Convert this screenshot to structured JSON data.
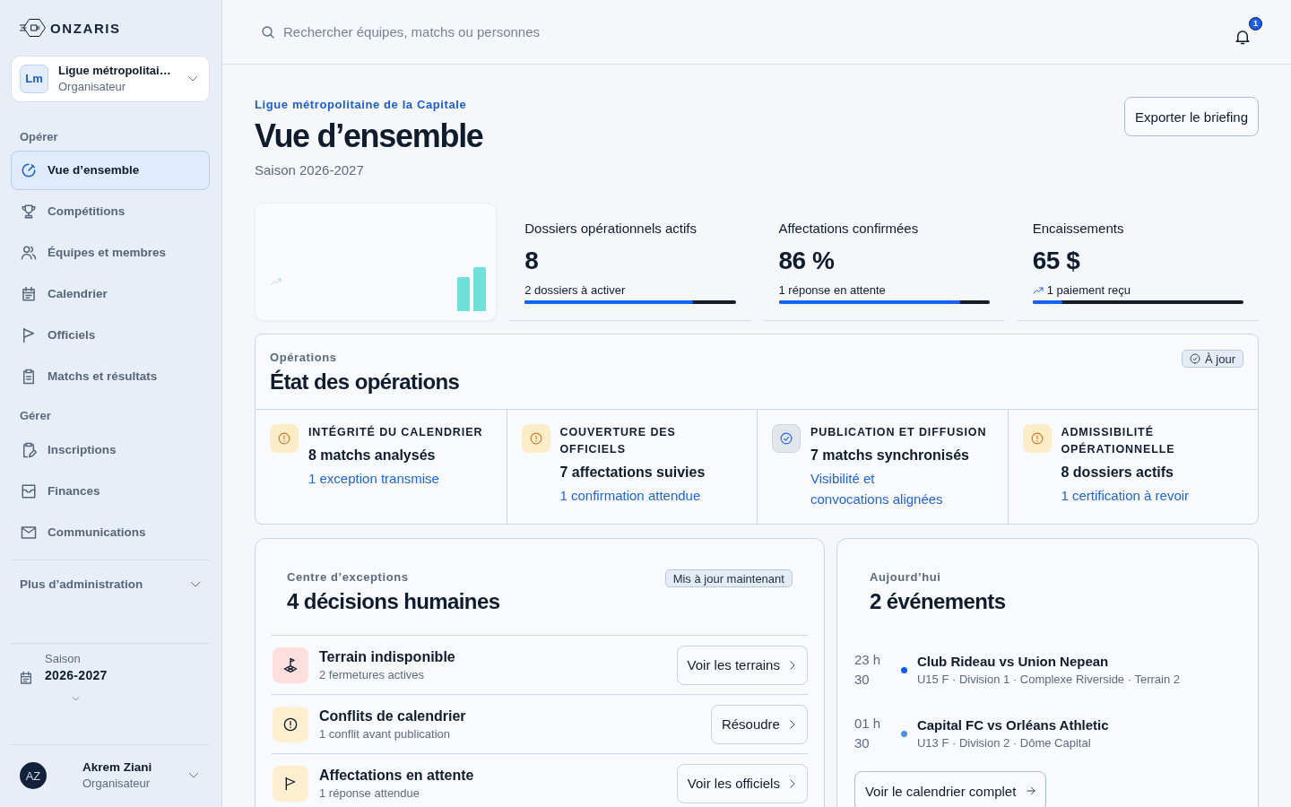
{
  "sidebar": {
    "brand": "ONZARIS",
    "org": {
      "initials": "Lm",
      "name": "Ligue métropolitai…",
      "role": "Organisateur"
    },
    "sections": [
      {
        "title": "Opérer",
        "items": [
          {
            "label": "Vue d’ensemble",
            "selected": true
          },
          {
            "label": "Compétitions",
            "selected": false
          },
          {
            "label": "Équipes et membres",
            "selected": false
          },
          {
            "label": "Calendrier",
            "selected": false
          },
          {
            "label": "Officiels",
            "selected": false
          },
          {
            "label": "Matchs et résultats",
            "selected": false
          }
        ]
      },
      {
        "title": "Gérer",
        "items": [
          {
            "label": "Inscriptions",
            "selected": false
          },
          {
            "label": "Finances",
            "selected": false
          },
          {
            "label": "Communications",
            "selected": false
          }
        ]
      }
    ],
    "more": {
      "label": "Plus d’administration",
      "expanded": false
    },
    "season": {
      "label": "Saison",
      "value": "2026-2027"
    },
    "user": {
      "initials": "AZ",
      "name": "Akrem Ziani",
      "role": "Organisateur"
    }
  },
  "header": {
    "search": {
      "placeholder": "Rechercher équipes, matchs ou personnes"
    },
    "notifications": {
      "badge": "1"
    }
  },
  "page": {
    "overline": "Ligue métropolitaine de la Capitale",
    "title": "Vue d’ensemble",
    "subtitle": "Saison 2026-2027",
    "export_button": "Exporter le briefing"
  },
  "kpis": [
    {
      "label": "Dossiers opérationnels actifs",
      "value": "8",
      "note": "2 dossiers à activer",
      "trend": false,
      "level": 0.8
    },
    {
      "label": "Affectations confirmées",
      "value": "86 %",
      "note": "1 réponse en attente",
      "trend": false,
      "level": 0.86
    },
    {
      "label": "Encaissements",
      "value": "65 $",
      "note": "1 paiement reçu",
      "trend": true,
      "level": 0.14
    }
  ],
  "operations": {
    "overline": "Opérations",
    "title": "État des opérations",
    "badge": "À jour",
    "items": [
      {
        "kind": "warning",
        "title": "INTÉGRITÉ DU CALENDRIER",
        "summary": "8 matchs analysés",
        "link": "1 exception transmise"
      },
      {
        "kind": "warning",
        "title": "COUVERTURE DES OFFICIELS",
        "summary": "7 affectations suivies",
        "link": "1 confirmation attendue"
      },
      {
        "kind": "ok",
        "title": "PUBLICATION ET DIFFUSION",
        "summary": "7 matchs synchronisés",
        "link": "Visibilité et convocations alignées"
      },
      {
        "kind": "warning",
        "title": "ADMISSIBILITÉ OPÉRATIONNELLE",
        "summary": "8 dossiers actifs",
        "link": "1 certification à revoir"
      }
    ]
  },
  "exceptions": {
    "overline": "Centre d’exceptions",
    "badge": "Mis à jour maintenant",
    "title": "4 décisions humaines",
    "items": [
      {
        "kind": "venue",
        "title": "Terrain indisponible",
        "detail": "2 fermetures actives",
        "action": "Voir les terrains"
      },
      {
        "kind": "conflict",
        "title": "Conflits de calendrier",
        "detail": "1 conflit avant publication",
        "action": "Résoudre"
      },
      {
        "kind": "assignment",
        "title": "Affectations en attente",
        "detail": "1 réponse attendue",
        "action": "Voir les officiels"
      }
    ]
  },
  "today": {
    "overline": "Aujourd’hui",
    "title": "2 événements",
    "events": [
      {
        "time": "23 h 30",
        "color": "#0b5cff",
        "title": "Club Rideau vs Union Nepean",
        "detail": "U15 F · Division 1 · Complexe Riverside · Terrain 2"
      },
      {
        "time": "01 h 30",
        "color": "#4a90e8",
        "title": "Capital FC vs Orléans Athletic",
        "detail": "U13 F · Division 2 · Dôme Capital"
      }
    ],
    "button": "Voir le calendrier complet"
  }
}
